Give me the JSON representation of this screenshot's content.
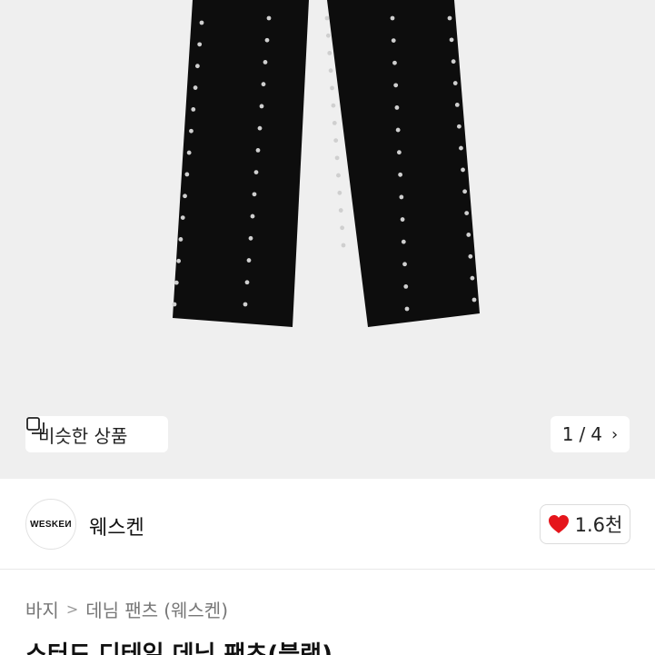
{
  "product_image": {
    "alt": "studded black denim pants",
    "similar_label": "비슷한 상품",
    "pager": {
      "current": "1",
      "separator": "/",
      "total": "4"
    }
  },
  "seller": {
    "logo_text": "WESKEИ",
    "name": "웨스켄",
    "likes": "1.6천"
  },
  "breadcrumb": [
    "바지",
    "데님 팬츠",
    "(웨스켄)"
  ],
  "product": {
    "title": "스터드 디테일 데님 팬츠(블랙)"
  },
  "colors": {
    "hero_bg": "#efefef",
    "pants": "#0d0d0d",
    "stud": "#cfcfcf",
    "heart": "#e5151b"
  }
}
